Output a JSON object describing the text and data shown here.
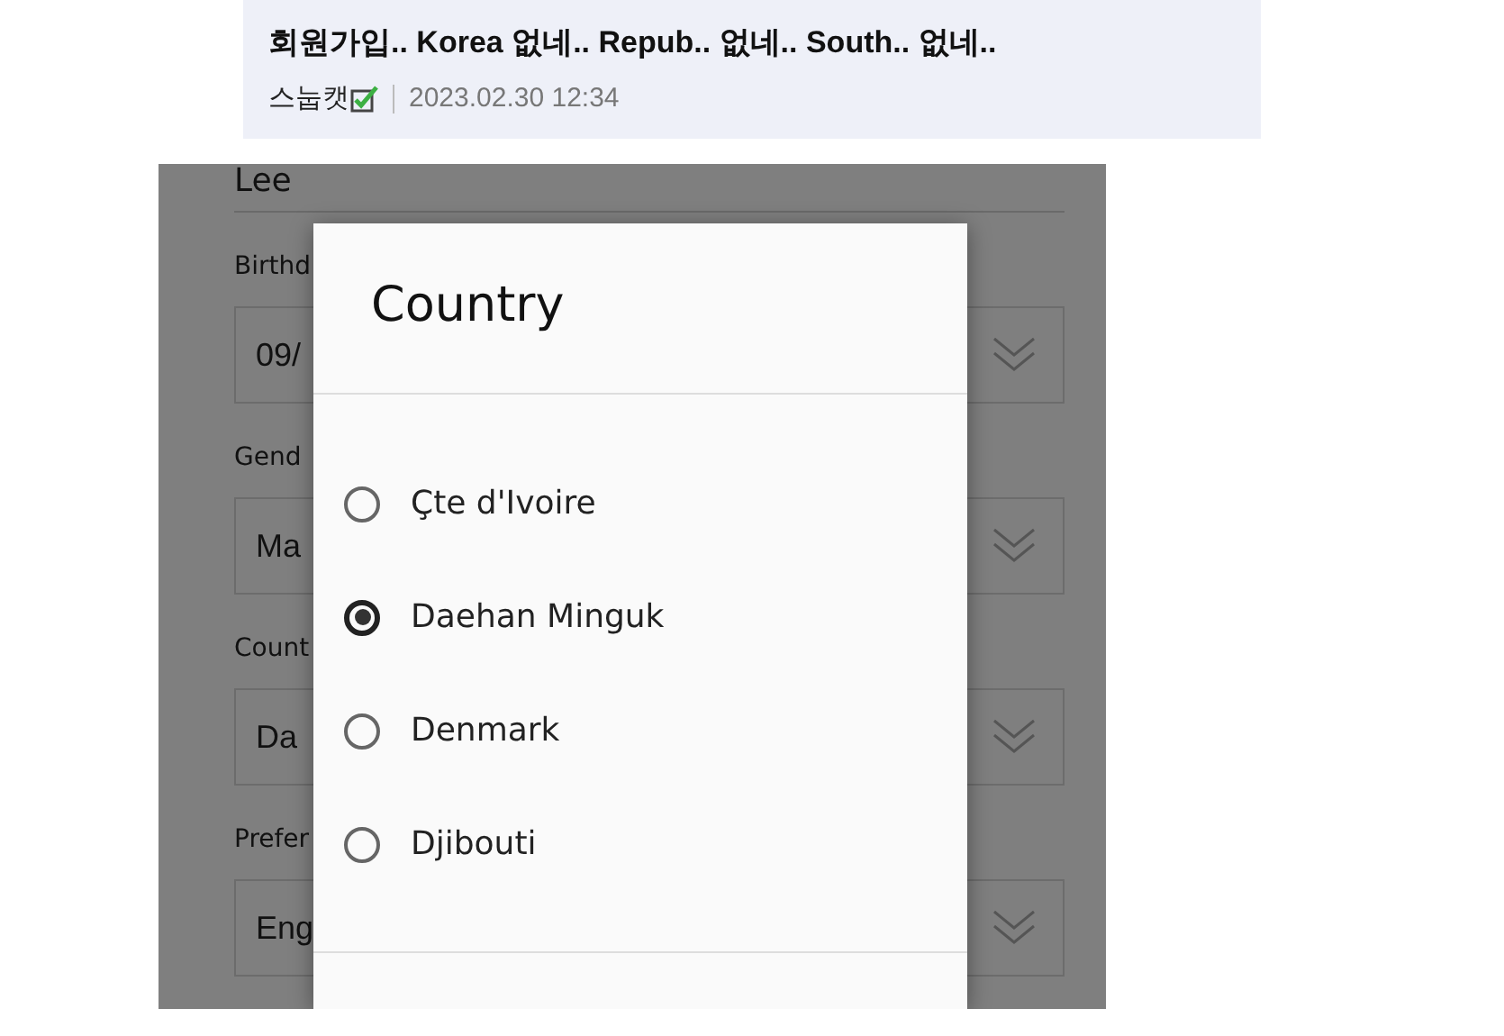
{
  "post": {
    "title": "회원가입.. Korea 없네.. Repub.. 없네.. South.. 없네..",
    "author": "스눕캣",
    "author_checked": true,
    "date": "2023.02.30 12:34"
  },
  "form": {
    "name_value": "Lee",
    "fields": [
      {
        "label": "Birthd",
        "value": "09/"
      },
      {
        "label": "Gend",
        "value": "Ma"
      },
      {
        "label": "Count",
        "value": "Da"
      },
      {
        "label": "Prefer",
        "value": "Eng"
      }
    ]
  },
  "dialog": {
    "title": "Country",
    "options": [
      {
        "label": "Çte d'Ivoire",
        "selected": false
      },
      {
        "label": "Daehan Minguk",
        "selected": true
      },
      {
        "label": "Denmark",
        "selected": false
      },
      {
        "label": "Djibouti",
        "selected": false
      }
    ]
  }
}
